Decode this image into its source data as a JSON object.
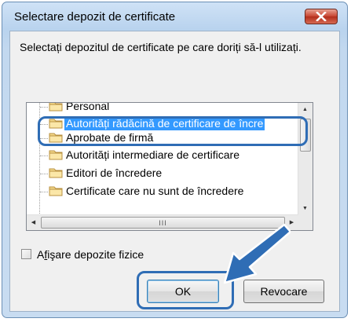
{
  "dialog": {
    "title": "Selectare depozit de certificate",
    "instruction": "Selectați depozitul de certificate pe care doriți să-l utilizați."
  },
  "tree": {
    "items": [
      {
        "label": "Personal",
        "selected": false
      },
      {
        "label": "Autorități rădăcină de certificare de încre",
        "selected": true
      },
      {
        "label": "Aprobate de firmă",
        "selected": false
      },
      {
        "label": "Autorități intermediare de certificare",
        "selected": false
      },
      {
        "label": "Editori de încredere",
        "selected": false
      },
      {
        "label": "Certificate care nu sunt de încredere",
        "selected": false
      }
    ],
    "hscroll_grip": "III"
  },
  "checkbox": {
    "label_prefix": "A",
    "label_underline": "f",
    "label_rest": "işare depozite fizice",
    "checked": false
  },
  "buttons": {
    "ok": "OK",
    "cancel": "Revocare"
  },
  "colors": {
    "annotation": "#2f6db5",
    "selection": "#3399ff",
    "close_button": "#c7432f"
  },
  "icons": {
    "close": "close-x-icon",
    "folder": "folder-icon",
    "pointer_arrow": "arrow-pointer-icon"
  }
}
